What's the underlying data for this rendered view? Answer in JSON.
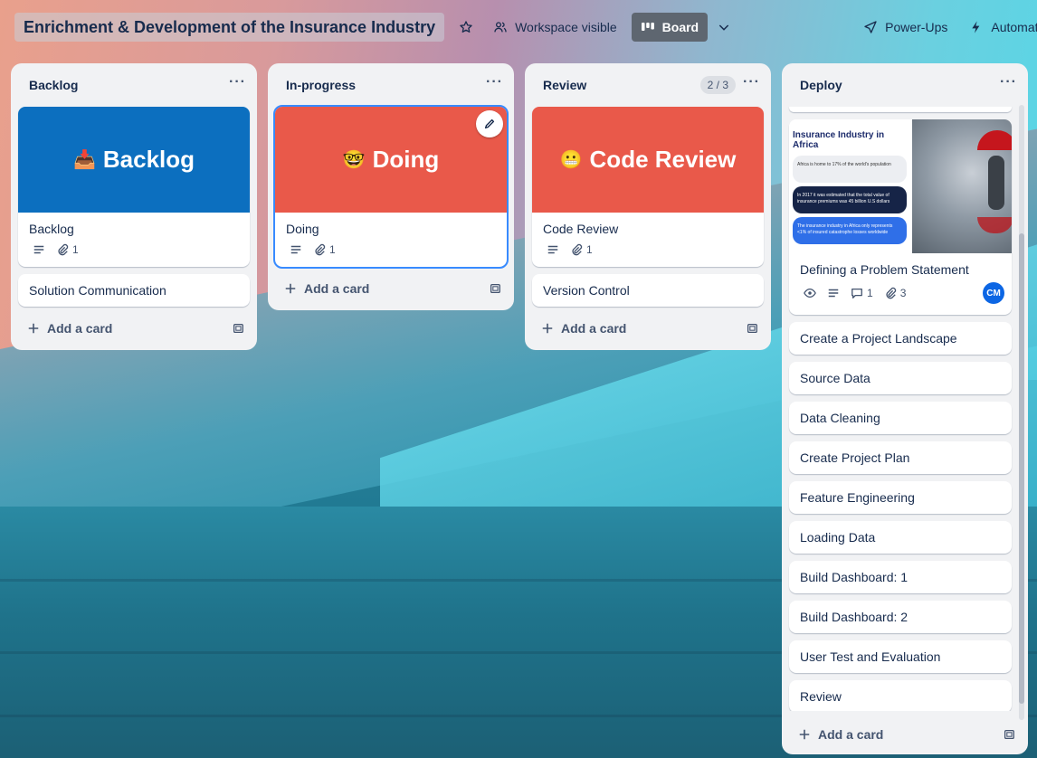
{
  "header": {
    "board_title": "Enrichment & Development of the Insurance Industry",
    "visibility_label": "Workspace visible",
    "view_label": "Board",
    "powerups_label": "Power-Ups",
    "automation_label": "Automati"
  },
  "lists": [
    {
      "title": "Backlog",
      "cards": [
        {
          "cover_text": "Backlog",
          "cover_emoji": "📥",
          "cover_color": "#0c6fbf",
          "title": "Backlog",
          "attachments": "1"
        },
        {
          "title": "Solution Communication"
        }
      ],
      "add_label": "Add a card"
    },
    {
      "title": "In-progress",
      "cards": [
        {
          "cover_text": "Doing",
          "cover_emoji": "🤓",
          "cover_color": "#e9594a",
          "title": "Doing",
          "attachments": "1"
        }
      ],
      "add_label": "Add a card"
    },
    {
      "title": "Review",
      "count": "2 / 3",
      "cards": [
        {
          "cover_text": "Code Review",
          "cover_emoji": "😬",
          "cover_color": "#e9594a",
          "title": "Code Review",
          "attachments": "1"
        },
        {
          "title": "Version Control"
        }
      ],
      "add_label": "Add a card"
    },
    {
      "title": "Deploy",
      "feature_card": {
        "image_title": "Insurance Industry in Africa",
        "pill1": "Africa is home to 17% of the world's population",
        "pill2": "In 2017 it was estimated that the total value of insurance premiums was 45 billion U.S dollars",
        "pill3": "The insurance industry in Africa only represents <1% of insured catastrophe losses worldwide",
        "title": "Defining a Problem Statement",
        "comments": "1",
        "attachments": "3",
        "avatar": "CM"
      },
      "cards": [
        "Create a Project Landscape",
        "Source Data",
        "Data Cleaning",
        "Create Project Plan",
        "Feature Engineering",
        "Loading Data",
        "Build Dashboard: 1",
        "Build Dashboard: 2",
        "User Test and Evaluation",
        "Review"
      ],
      "add_label": "Add a card"
    }
  ]
}
